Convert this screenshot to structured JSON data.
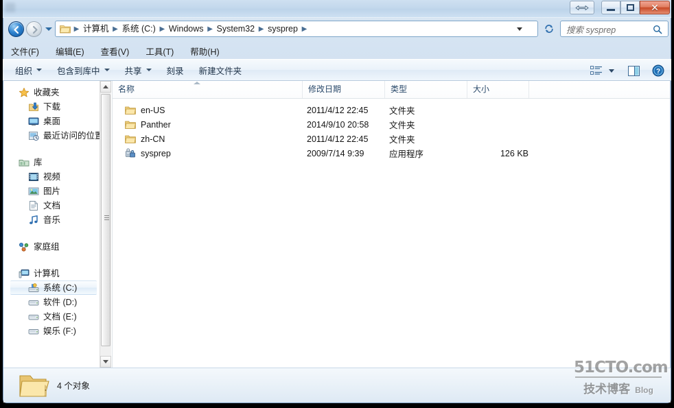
{
  "window": {
    "title": "",
    "controls": {
      "restore_label": "restore-window",
      "minimize_label": "minimize",
      "maximize_label": "maximize",
      "close_label": "✕"
    }
  },
  "address_bar": {
    "back_tooltip": "后退",
    "forward_tooltip": "前进",
    "history_tooltip": "最近的位置",
    "refresh_tooltip": "刷新",
    "separator": "▶",
    "breadcrumbs": [
      "计算机",
      "系统 (C:)",
      "Windows",
      "System32",
      "sysprep"
    ]
  },
  "search": {
    "placeholder": "搜索 sysprep",
    "icon": "search-icon"
  },
  "menubar": {
    "items": [
      {
        "label": "文件(F)"
      },
      {
        "label": "编辑(E)"
      },
      {
        "label": "查看(V)"
      },
      {
        "label": "工具(T)"
      },
      {
        "label": "帮助(H)"
      }
    ]
  },
  "commandbar": {
    "items": [
      {
        "label": "组织",
        "caret": true
      },
      {
        "label": "包含到库中",
        "caret": true
      },
      {
        "label": "共享",
        "caret": true
      },
      {
        "label": "刻录",
        "caret": false
      },
      {
        "label": "新建文件夹",
        "caret": false
      }
    ],
    "right_icons": [
      {
        "name": "view-options-icon"
      },
      {
        "name": "preview-pane-icon"
      },
      {
        "name": "help-icon"
      }
    ]
  },
  "sidebar": {
    "groups": [
      {
        "header": {
          "label": "收藏夹",
          "icon": "star-icon"
        },
        "items": [
          {
            "label": "下载",
            "icon": "download-icon",
            "selected": false
          },
          {
            "label": "桌面",
            "icon": "desktop-icon",
            "selected": false
          },
          {
            "label": "最近访问的位置",
            "icon": "recent-places-icon",
            "selected": false
          }
        ]
      },
      {
        "header": {
          "label": "库",
          "icon": "library-icon"
        },
        "items": [
          {
            "label": "视频",
            "icon": "videos-icon",
            "selected": false
          },
          {
            "label": "图片",
            "icon": "pictures-icon",
            "selected": false
          },
          {
            "label": "文档",
            "icon": "documents-icon",
            "selected": false
          },
          {
            "label": "音乐",
            "icon": "music-icon",
            "selected": false
          }
        ]
      },
      {
        "header": {
          "label": "家庭组",
          "icon": "homegroup-icon"
        },
        "items": []
      },
      {
        "header": {
          "label": "计算机",
          "icon": "computer-icon"
        },
        "items": [
          {
            "label": "系统 (C:)",
            "icon": "system-drive-icon",
            "selected": true
          },
          {
            "label": "软件 (D:)",
            "icon": "drive-icon",
            "selected": false
          },
          {
            "label": "文档 (E:)",
            "icon": "drive-icon",
            "selected": false
          },
          {
            "label": "娱乐 (F:)",
            "icon": "drive-icon",
            "selected": false
          }
        ]
      }
    ]
  },
  "filelist": {
    "columns": [
      {
        "label": "名称",
        "sorted": "asc"
      },
      {
        "label": "修改日期",
        "sorted": ""
      },
      {
        "label": "类型",
        "sorted": ""
      },
      {
        "label": "大小",
        "sorted": ""
      }
    ],
    "rows": [
      {
        "name": "en-US",
        "date": "2011/4/12 22:45",
        "type": "文件夹",
        "size": "",
        "icon": "folder-icon"
      },
      {
        "name": "Panther",
        "date": "2014/9/10 20:58",
        "type": "文件夹",
        "size": "",
        "icon": "folder-icon"
      },
      {
        "name": "zh-CN",
        "date": "2011/4/12 22:45",
        "type": "文件夹",
        "size": "",
        "icon": "folder-icon"
      },
      {
        "name": "sysprep",
        "date": "2009/7/14 9:39",
        "type": "应用程序",
        "size": "126 KB",
        "icon": "application-icon"
      }
    ]
  },
  "statusbar": {
    "item_count_text": "4 个对象",
    "icon": "large-folder-icon"
  },
  "watermark": {
    "line1": "51CTO.com",
    "line2": "技术博客",
    "line3": "Blog"
  },
  "colors": {
    "accent": "#2f84d0",
    "close_button": "#c84a28",
    "folder_yellow": "#f0c060",
    "selection": "#dfecf8"
  }
}
